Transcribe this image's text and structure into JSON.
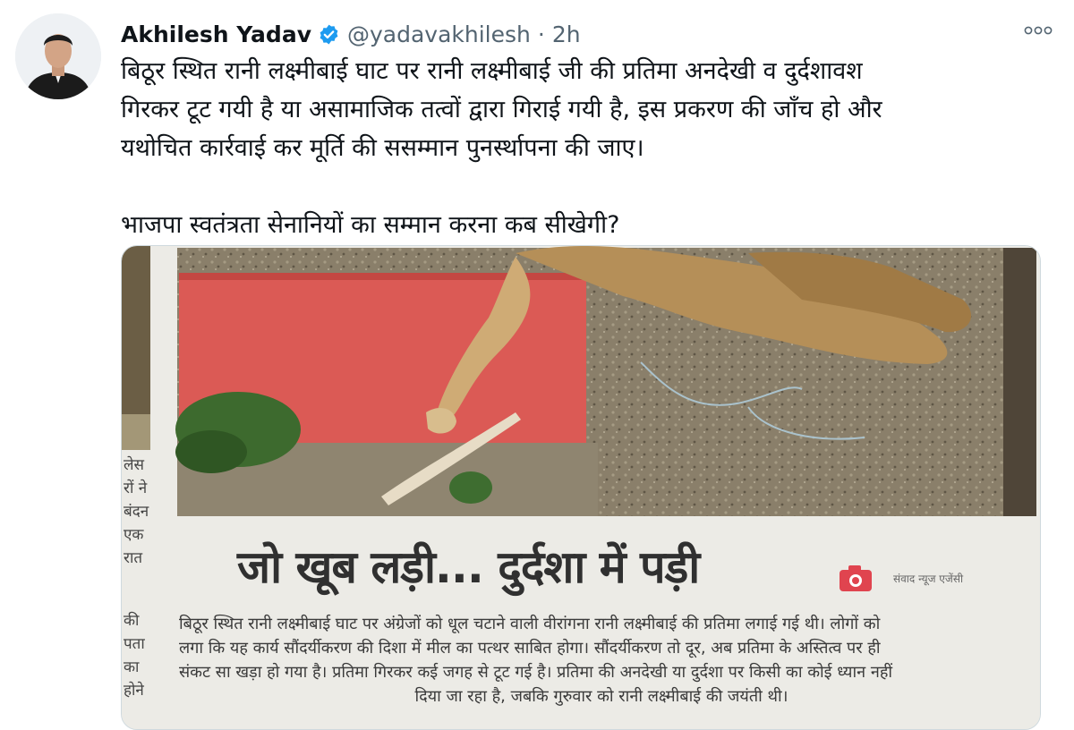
{
  "tweet": {
    "author_name": "Akhilesh Yadav",
    "handle": "@yadavakhilesh",
    "separator": "·",
    "time": "2h",
    "text": "बिठूर स्थित रानी लक्ष्मीबाई घाट पर रानी लक्ष्मीबाई जी की प्रतिमा अनदेखी व दुर्दशावश\nगिरकर टूट गयी है या असामाजिक तत्वों द्वारा गिराई गयी है, इस प्रकरण की जाँच हो और\nयथोचित कार्रवाई कर मूर्ति की ससम्मान पुनर्स्थापना की जाए।\n\nभाजपा स्वतंत्रता सेनानियों का सम्मान करना कब सीखेगी?",
    "icons": {
      "verified": "verified-badge-icon",
      "more": "more-options-icon",
      "camera": "camera-icon"
    },
    "colors": {
      "verified": "#1d9bf0",
      "secondary": "#536471",
      "camera": "#e0444f"
    }
  },
  "clipping": {
    "headline": "जो खूब लड़ी... दुर्दशा में पड़ी",
    "credit": "संवाद न्यूज एजेंसी",
    "article_lines": [
      "बिठूर स्थित रानी लक्ष्मीबाई घाट पर अंग्रेजों को धूल चटाने वाली वीरांगना रानी लक्ष्मीबाई की प्रतिमा लगाई गई थी। लोगों को",
      "लगा कि यह कार्य सौंदर्यीकरण की दिशा में मील का पत्थर साबित होगा। सौंदर्यीकरण तो दूर, अब प्रतिमा के अस्तित्व पर ही",
      "संकट सा खड़ा हो गया है। प्रतिमा गिरकर कई जगह से टूट गई है। प्रतिमा की अनदेखी या दुर्दशा पर किसी का कोई ध्यान नहीं",
      "दिया जा रहा है, जबकि गुरुवार को रानी लक्ष्मीबाई की जयंती थी।"
    ],
    "side_column_a": [
      "लेस",
      "रों ने",
      "बंदन",
      "एक",
      "रात"
    ],
    "side_column_b": [
      "की",
      "पता",
      "का",
      "होने"
    ]
  }
}
